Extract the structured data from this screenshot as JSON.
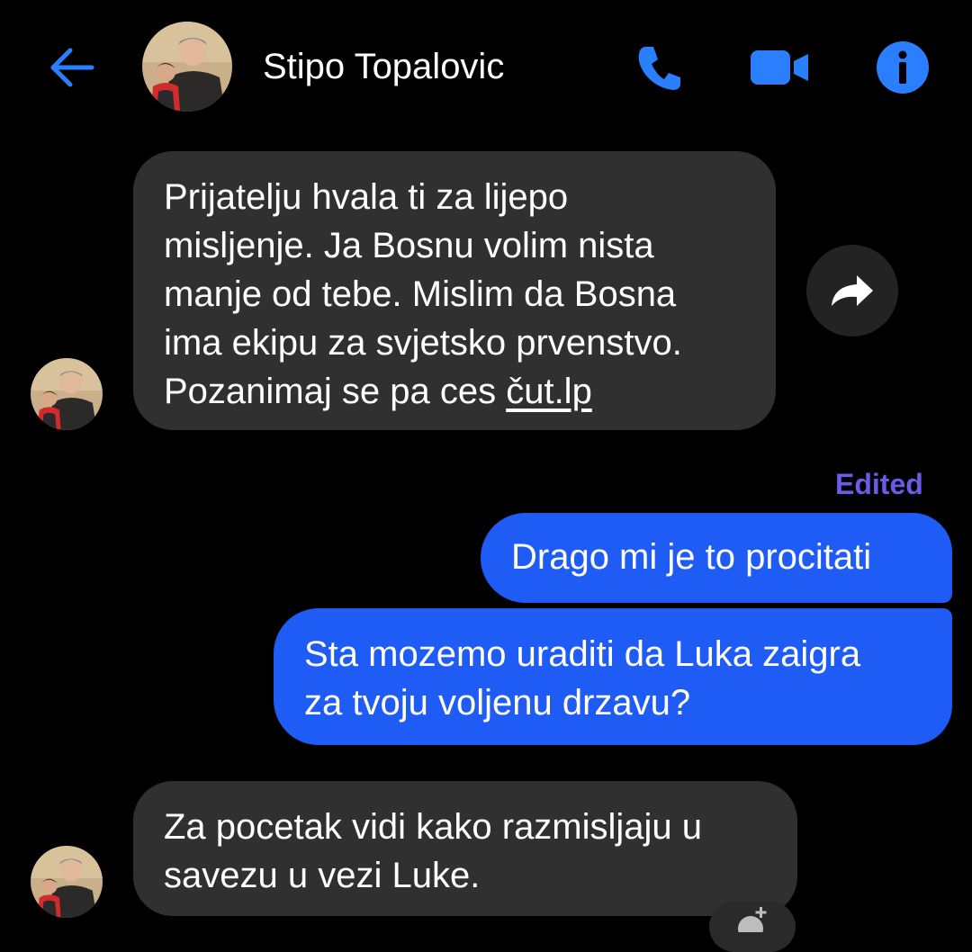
{
  "header": {
    "contact_name": "Stipo Topalovic"
  },
  "icons": {
    "back": "arrow-left-icon",
    "call": "phone-icon",
    "video": "video-camera-icon",
    "info": "info-icon",
    "forward": "forward-arrow-icon",
    "react": "add-reaction-icon"
  },
  "colors": {
    "accent": "#1f5cf6",
    "icon_blue": "#2a7fff",
    "incoming_bubble": "#303030",
    "edited": "#6a5ce8",
    "background": "#000000"
  },
  "messages": [
    {
      "direction": "incoming",
      "lines": [
        "Prijatelju hvala ti za lijepo",
        "misljenje. Ja Bosnu volim nista",
        "manje od tebe. Mislim da Bosna",
        "ima ekipu za svjetsko prvenstvo."
      ],
      "last_line_prefix": "Pozanimaj se pa ces ",
      "last_line_link": "čut.lp"
    },
    {
      "direction": "outgoing",
      "status": "Edited",
      "lines": [
        "Drago mi je to procitati"
      ]
    },
    {
      "direction": "outgoing",
      "lines": [
        "Sta mozemo uraditi da Luka zaigra",
        "za tvoju voljenu drzavu?"
      ]
    },
    {
      "direction": "incoming",
      "lines": [
        "Za pocetak vidi kako razmisljaju u",
        "savezu u vezi Luke."
      ]
    }
  ]
}
